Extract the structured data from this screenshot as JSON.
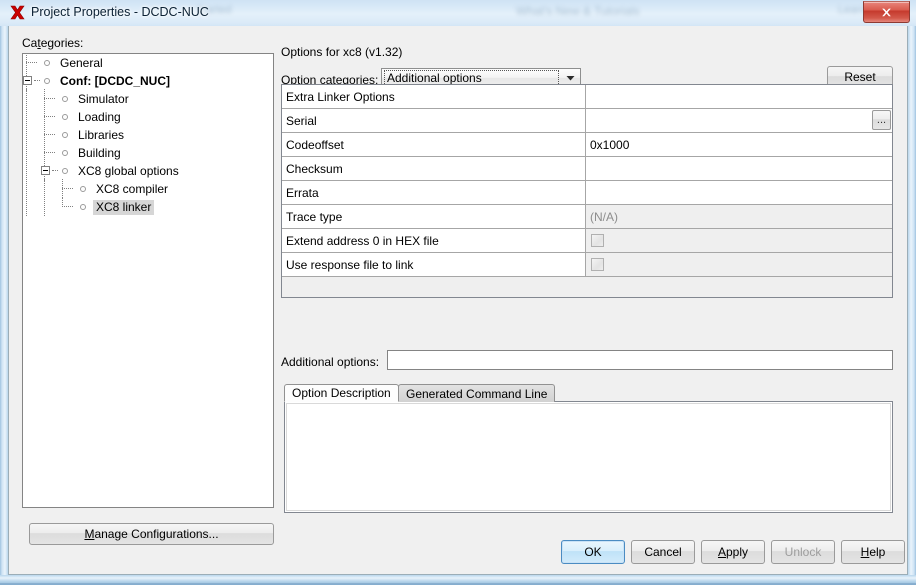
{
  "window": {
    "title": "Project Properties - DCDC-NUC",
    "icon": "mplab-x-icon",
    "close_label": "x",
    "glass_bleed": [
      "Started",
      "What's New & Tutorials",
      "Learn & D"
    ]
  },
  "sidebar": {
    "label": "Categories:",
    "label_mnemonic": "t",
    "items": [
      {
        "label": "General",
        "depth": 0,
        "bold": false,
        "selected": false,
        "expander": "none",
        "last": false
      },
      {
        "label": "Conf: [DCDC_NUC]",
        "depth": 0,
        "bold": true,
        "selected": false,
        "expander": "minus",
        "last": true
      },
      {
        "label": "Simulator",
        "depth": 1,
        "bold": false,
        "selected": false,
        "expander": "none",
        "last": false
      },
      {
        "label": "Loading",
        "depth": 1,
        "bold": false,
        "selected": false,
        "expander": "none",
        "last": false
      },
      {
        "label": "Libraries",
        "depth": 1,
        "bold": false,
        "selected": false,
        "expander": "none",
        "last": false
      },
      {
        "label": "Building",
        "depth": 1,
        "bold": false,
        "selected": false,
        "expander": "none",
        "last": false
      },
      {
        "label": "XC8 global options",
        "depth": 1,
        "bold": false,
        "selected": false,
        "expander": "minus",
        "last": true
      },
      {
        "label": "XC8 compiler",
        "depth": 2,
        "bold": false,
        "selected": false,
        "expander": "none",
        "last": false
      },
      {
        "label": "XC8 linker",
        "depth": 2,
        "bold": false,
        "selected": true,
        "expander": "none",
        "last": true
      }
    ],
    "manage_button": "Manage Configurations...",
    "manage_mnemonic": "M"
  },
  "options_pane": {
    "title": "Options for xc8 (v1.32)",
    "category_label": "Option categories:",
    "category_value": "Additional options",
    "reset_button": "Reset",
    "dropdown_icon": "chevron-down-icon",
    "rows": [
      {
        "name": "Extra Linker Options",
        "value": "",
        "kind": "text",
        "enabled": true
      },
      {
        "name": "Serial",
        "value": "",
        "kind": "browse",
        "enabled": true,
        "browse_label": "..."
      },
      {
        "name": "Codeoffset",
        "value": "0x1000",
        "kind": "text",
        "enabled": true
      },
      {
        "name": "Checksum",
        "value": "",
        "kind": "text",
        "enabled": true
      },
      {
        "name": "Errata",
        "value": "",
        "kind": "text",
        "enabled": true
      },
      {
        "name": "Trace type",
        "value": "(N/A)",
        "kind": "readonly",
        "enabled": false
      },
      {
        "name": "Extend address 0 in HEX file",
        "value": "",
        "kind": "checkbox",
        "enabled": false,
        "checked": false
      },
      {
        "name": "Use response file to link",
        "value": "",
        "kind": "checkbox",
        "enabled": false,
        "checked": false
      }
    ],
    "additional_options_label": "Additional options:",
    "additional_options_value": "",
    "tabs": [
      {
        "label": "Option Description",
        "active": true
      },
      {
        "label": "Generated Command Line",
        "active": false
      }
    ],
    "description_text": ""
  },
  "footer": {
    "buttons": [
      {
        "label": "OK",
        "mnemonic": "",
        "style": "default",
        "enabled": true
      },
      {
        "label": "Cancel",
        "mnemonic": "",
        "style": "normal",
        "enabled": true
      },
      {
        "label": "Apply",
        "mnemonic": "A",
        "style": "normal",
        "enabled": true
      },
      {
        "label": "Unlock",
        "mnemonic": "",
        "style": "normal",
        "enabled": false
      },
      {
        "label": "Help",
        "mnemonic": "H",
        "style": "normal",
        "enabled": true
      }
    ]
  },
  "colors": {
    "accent": "#4b8cc2",
    "close_red": "#c5392c",
    "glass": "#d6e8f7",
    "dialog_bg": "#f0f0f0",
    "selection": "#d6d6d6"
  }
}
